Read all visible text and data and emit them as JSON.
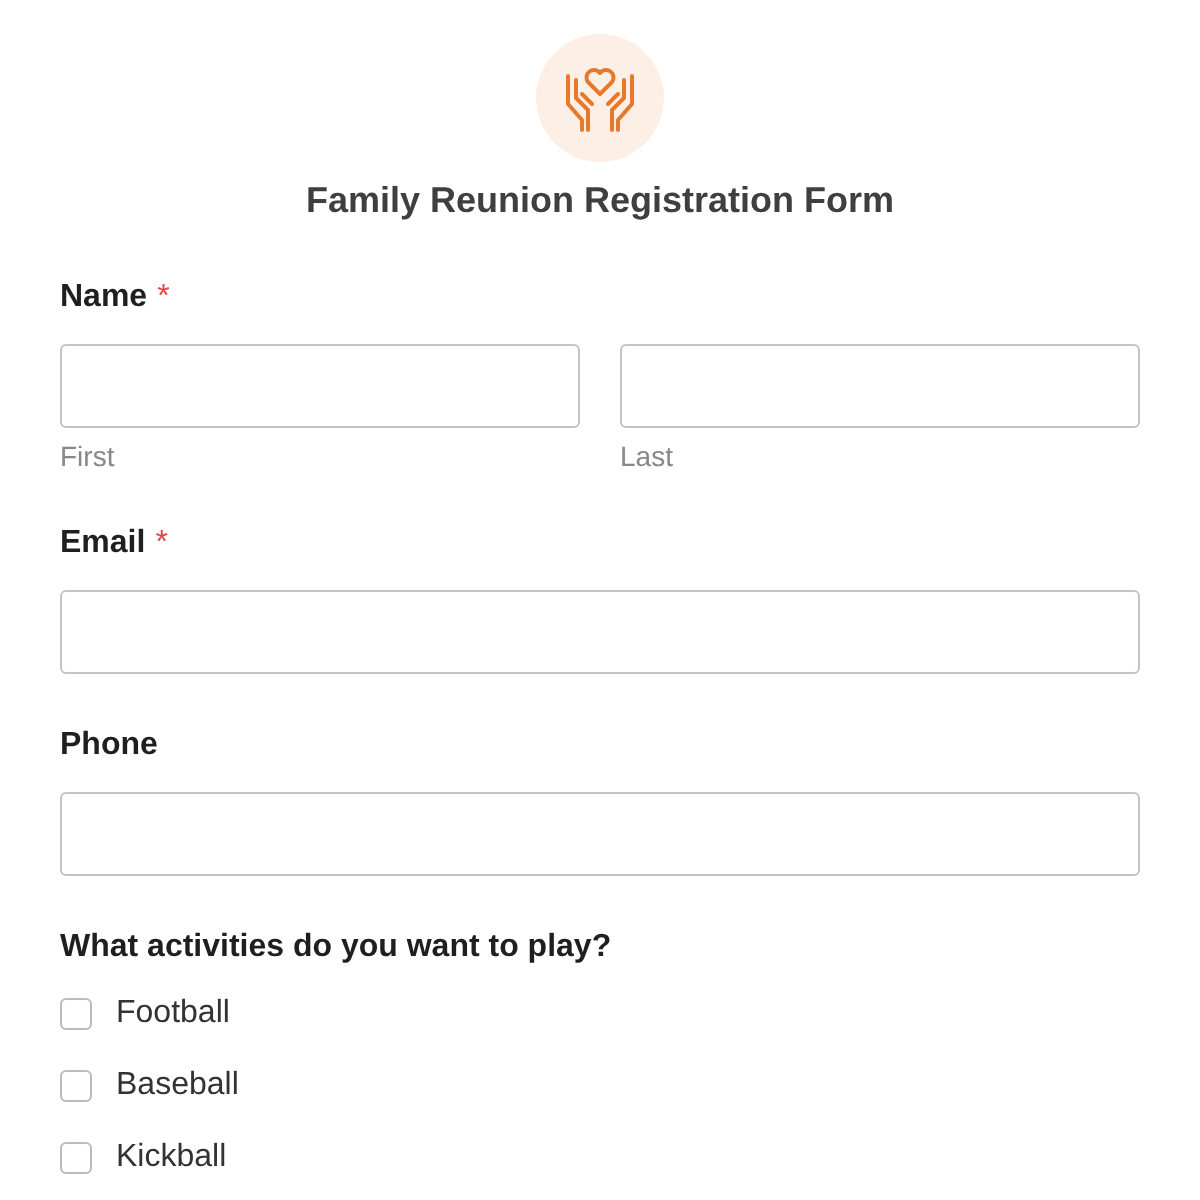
{
  "form": {
    "title": "Family Reunion Registration Form"
  },
  "fields": [
    {
      "kind": "name",
      "label": "Name",
      "required_mark": "*",
      "inputs": [
        {
          "sublabel": "First"
        },
        {
          "sublabel": "Last"
        }
      ]
    },
    {
      "kind": "single",
      "label": "Email",
      "required_mark": "*"
    },
    {
      "kind": "single",
      "label": "Phone"
    },
    {
      "kind": "checkboxes",
      "label": "What activities do you want to play?",
      "options": [
        {
          "label": "Football",
          "checked": false
        },
        {
          "label": "Baseball",
          "checked": false
        },
        {
          "label": "Kickball",
          "checked": false
        }
      ]
    }
  ]
}
